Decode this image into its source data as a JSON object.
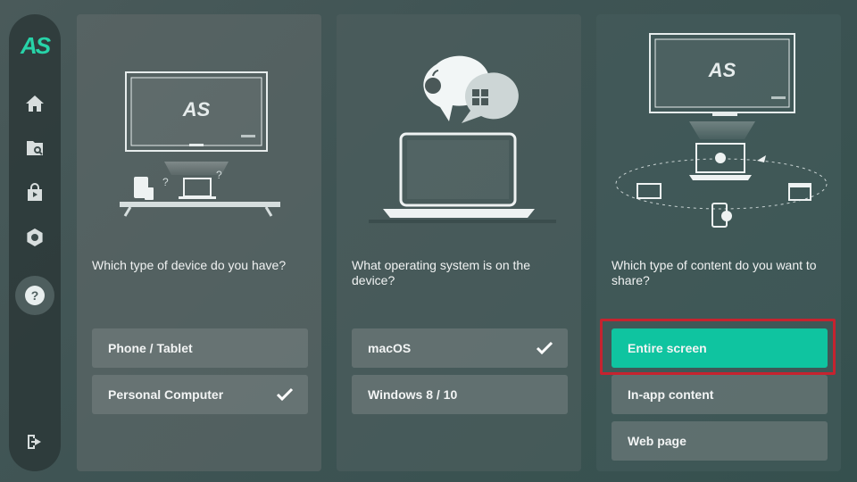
{
  "app": {
    "logo_text": "AS"
  },
  "sidebar": {
    "items": [
      {
        "name": "home",
        "icon": "home-icon"
      },
      {
        "name": "file-search",
        "icon": "file-search-icon"
      },
      {
        "name": "store",
        "icon": "store-bag-icon"
      },
      {
        "name": "settings",
        "icon": "gear-icon"
      },
      {
        "name": "help",
        "icon": "help-icon",
        "active": true
      },
      {
        "name": "logout",
        "icon": "logout-icon"
      }
    ]
  },
  "cards": [
    {
      "question": "Which type of device do you have?",
      "illustration_logo": "AS",
      "options": [
        {
          "label": "Phone / Tablet",
          "checked": false
        },
        {
          "label": "Personal Computer",
          "checked": true
        }
      ]
    },
    {
      "question": "What operating system is on the device?",
      "options": [
        {
          "label": "macOS",
          "checked": true
        },
        {
          "label": "Windows 8 / 10",
          "checked": false
        }
      ]
    },
    {
      "question": "Which type of content do you want to share?",
      "illustration_logo": "AS",
      "options": [
        {
          "label": "Entire screen",
          "selected": true
        },
        {
          "label": "In-app content",
          "selected": false
        },
        {
          "label": "Web page",
          "selected": false
        }
      ]
    }
  ],
  "colors": {
    "accent": "#0fc4a0",
    "logo": "#27d3a8",
    "highlight": "#c6232f"
  }
}
